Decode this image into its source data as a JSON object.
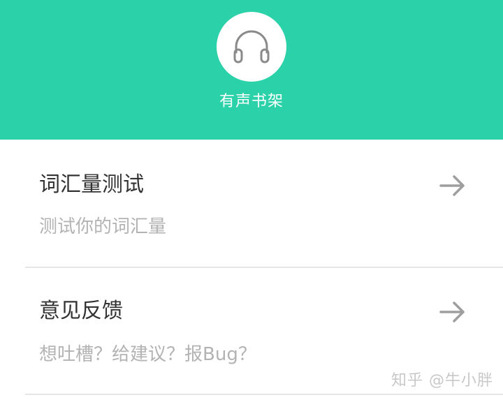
{
  "header": {
    "icon": "headphones-icon",
    "label": "有声书架",
    "background": "#2bd1a9"
  },
  "items": [
    {
      "title": "词汇量测试",
      "subtitle": "测试你的词汇量",
      "icon": "arrow-right-icon"
    },
    {
      "title": "意见反馈",
      "subtitle": "想吐槽？给建议？报Bug？",
      "icon": "arrow-right-icon"
    }
  ],
  "watermark": "知乎 @牛小胖",
  "colors": {
    "title_text": "#333333",
    "subtitle_text": "#b3b3b3",
    "arrow": "#9e9e9e",
    "divider": "#e6e6e6"
  }
}
